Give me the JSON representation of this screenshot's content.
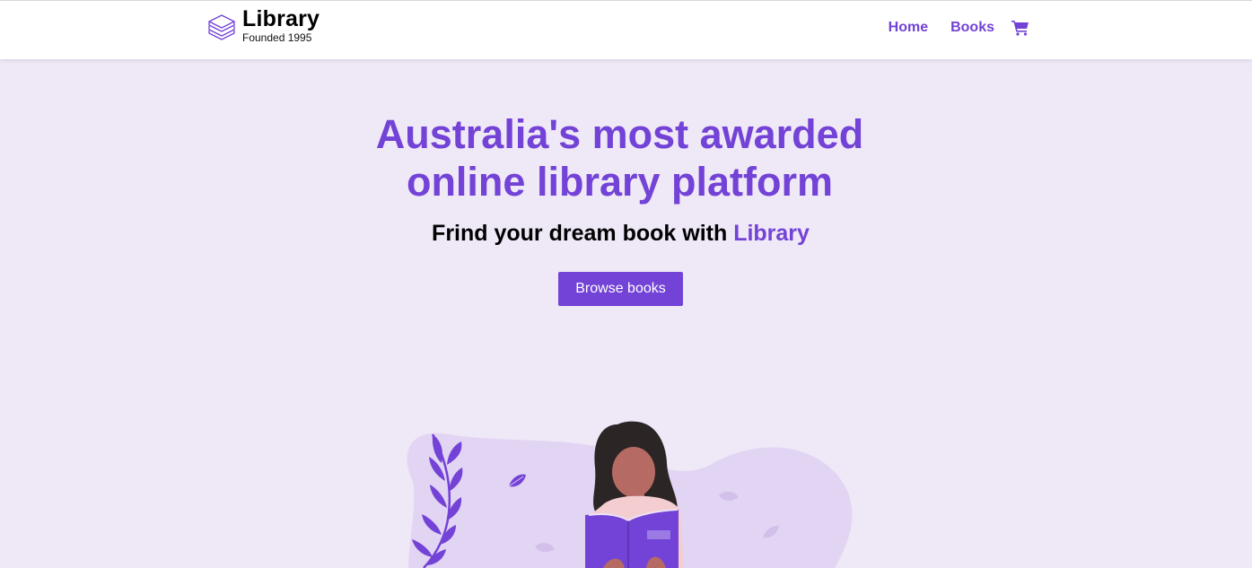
{
  "header": {
    "logo_title": "Library",
    "logo_subtitle": "Founded 1995",
    "nav": [
      {
        "label": "Home"
      },
      {
        "label": "Books"
      }
    ],
    "cart_icon": "shopping-cart-icon"
  },
  "hero": {
    "title_line1": "Australia's most awarded",
    "title_line2": "online library platform",
    "subtitle_prefix": "Frind your dream book with ",
    "subtitle_accent": "Library",
    "cta_label": "Browse books"
  },
  "colors": {
    "accent": "#7342d6",
    "hero_background": "#efe8f7",
    "blob": "#e2d5f3"
  }
}
